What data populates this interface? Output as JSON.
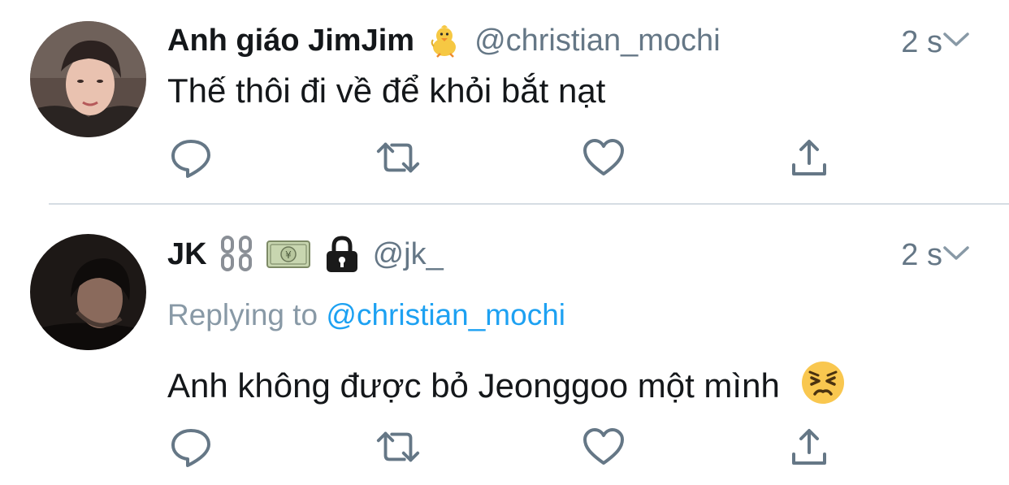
{
  "tweets": [
    {
      "display_name": "Anh giáo JimJim",
      "name_emojis": [
        "baby-chick"
      ],
      "handle": "@christian_mochi",
      "time": "2 s",
      "text": "Thế thôi đi về để khỏi bắt nạt",
      "replying_to_label": "",
      "replying_to_handle": ""
    },
    {
      "display_name": "JK",
      "name_emojis": [
        "chains",
        "money-bill",
        "lock"
      ],
      "handle": "@jk_",
      "time": "2 s",
      "text": "Anh không được bỏ Jeonggoo một mình",
      "text_emoji": "persevering-face",
      "replying_to_label": "Replying to",
      "replying_to_handle": "@christian_mochi"
    }
  ],
  "actions": [
    "reply-icon",
    "retweet-icon",
    "like-icon",
    "share-icon"
  ],
  "colors": {
    "text": "#14171a",
    "secondary": "#657786",
    "link": "#1da1f2",
    "icon": "#657786",
    "divider": "#d6dde3"
  }
}
